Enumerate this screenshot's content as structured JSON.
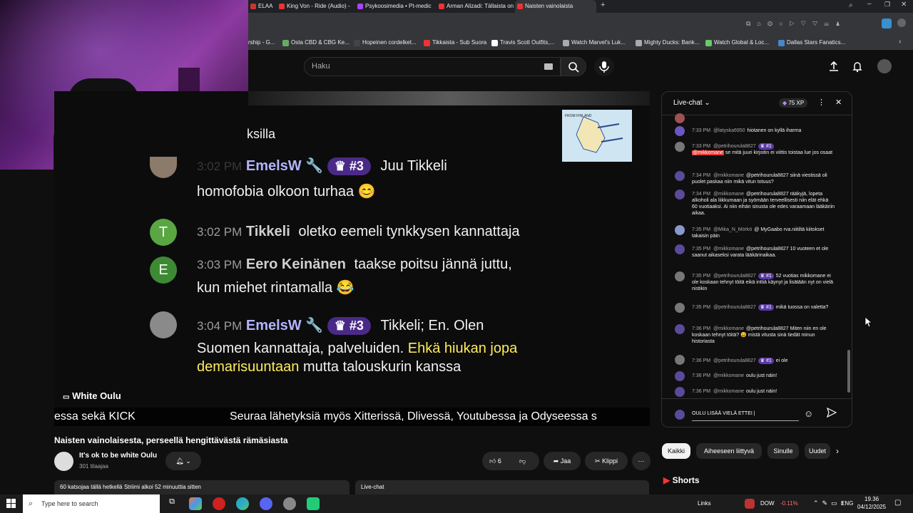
{
  "browser": {
    "tabs": [
      {
        "label": "ELAA",
        "color": "#c33"
      },
      {
        "label": "King Von - Ride (Audio) -",
        "color": "#e33"
      },
      {
        "label": "Psykoosimedia • Pt-medic",
        "color": "#a4f"
      },
      {
        "label": "Arman Alizadi: Tällaista on",
        "color": "#e33"
      },
      {
        "label": "Naisten vainolaista",
        "color": "#e33"
      }
    ],
    "bookmarks": [
      {
        "label": "rship - G...",
        "color": "#888"
      },
      {
        "label": "Osta CBD & CBG Ke...",
        "color": "#6a6"
      },
      {
        "label": "Hopeinen cordelket...",
        "color": "#444"
      },
      {
        "label": "Tikkaista - Sub Suora",
        "color": "#e33"
      },
      {
        "label": "Travis Scott Outfits,...",
        "color": "#fff"
      },
      {
        "label": "Watch Marvel's Luk...",
        "color": "#aaa"
      },
      {
        "label": "Mighty Ducks: Bank...",
        "color": "#aaa"
      },
      {
        "label": "Watch Global & Loc...",
        "color": "#6c6"
      },
      {
        "label": "Dallas Stars Fanatics...",
        "color": "#48c"
      }
    ]
  },
  "header": {
    "search_placeholder": "Haku"
  },
  "video": {
    "partial_top": "ksilla",
    "messages": [
      {
        "time": "3:02 PM",
        "name": "EmelsW",
        "rank": "#3",
        "text1": "Juu Tikkeli",
        "text2": "homofobia olkoon turhaa 😊"
      },
      {
        "avatar_letter": "T",
        "time": "3:02 PM",
        "name": "Tikkeli",
        "text1": "oletko eemeli tynkkysen kannattaja"
      },
      {
        "avatar_letter": "E",
        "time": "3:03 PM",
        "name": "Eero Keinänen",
        "text1": "taakse poitsu jännä juttu,",
        "text2": "kun miehet rintamalla 😂"
      },
      {
        "time": "3:04 PM",
        "name": "EmelsW",
        "rank": "#3",
        "text1": "Tikkeli; En. Olen",
        "text2a": "Suomen kannattaja, palveluiden.",
        "text2b": "Ehkä hiukan jopa",
        "text3a": "demarisuuntaan",
        "text3b": "mutta talouskurin kanssa"
      }
    ],
    "channel_overlay": "White Oulu",
    "ticker_left": "essa sekä KICK",
    "ticker_main": "Seuraa lähetyksiä myös Xitterissä, Dlivessä, Youtubessa ja Odyseessa s"
  },
  "below": {
    "title": "Naisten vainolaisesta, perseellä hengittävästä rämäsiasta",
    "channel": "It's ok to be white Oulu",
    "subs": "301 tilaajaa",
    "likes": "6",
    "share": "Jaa",
    "clip": "Klippi",
    "desc": "60 katsojaa tällä hetkellä Striimi alkoi 52 minuuttia sitten",
    "livechat_label": "Live-chat"
  },
  "chat": {
    "title": "Live-chat",
    "xp": "75 XP",
    "messages": [
      {
        "time": "7:33 PM",
        "user": "@latyska6950",
        "text": "hiotanen on kyllä iharma"
      },
      {
        "time": "7:33 PM",
        "user": "@petrihourula8827",
        "badge": "#1",
        "mention": "@mikkomane",
        "text": "se mitä juuri kirjoitin ei viittis toistaa lue jos osaat"
      },
      {
        "time": "7:34 PM",
        "user": "@mikkomane",
        "text": "@petrihourula8827 siinä viestissä oli puolet paskaa niin mikä vitun totuus?"
      },
      {
        "time": "7:34 PM",
        "user": "@mikkomane",
        "text": "@petrihourula8827 rääkyjä, lopeta alkoholi ala liikkumaan ja syömään terveellisesti niin elät ehkä 60 vuotiaaksi. Ai niin eihän sinusta ole edes varaamaan lääkäriin aikaa."
      },
      {
        "time": "7:35 PM",
        "user": "@Mika_N_Mörkö",
        "text": "@ MyGaabo rva.niitiltä kiitokset takaisin päin"
      },
      {
        "time": "7:35 PM",
        "user": "@mikkomane",
        "text": "@petrihourula8827 10 vuoteen et ole saanut aikaseksi varata lääkärinaikaa."
      },
      {
        "time": "7:35 PM",
        "user": "@petrihourula8827",
        "badge": "#1",
        "text": "52 vuotias mikkomane ei ole koskaan tehnyt töitä eikä inttiä käynyt ja lisätään nyt on vielä nistikin"
      },
      {
        "time": "7:35 PM",
        "user": "@petrihourula8827",
        "badge": "#1",
        "text": "mikä tuossa on valetta?"
      },
      {
        "time": "7:36 PM",
        "user": "@mikkomane",
        "text": "@petrihourula8827 Miten niin en ole koskaan tehnyt töitä? 😀 mistä vitusta sinä tiedät minun historiasta"
      },
      {
        "time": "7:36 PM",
        "user": "@petrihourula8827",
        "badge": "#1",
        "text": "ei ole"
      },
      {
        "time": "7:36 PM",
        "user": "@mikkomane",
        "text": "oulu just näin!"
      },
      {
        "time": "7:36 PM",
        "user": "@mikkomane",
        "text": "oulu just näin!"
      }
    ],
    "input_text": "OULU LISÄÄ VIELÄ ETTEI |"
  },
  "chips": [
    "Kaikki",
    "Aiheeseen liittyvä",
    "Sinulle",
    "Uudet"
  ],
  "shorts_label": "Shorts",
  "taskbar": {
    "search_placeholder": "Type here to search",
    "links": "Links",
    "stock": "DOW",
    "stock_change": "-0.11%",
    "lang": "ENG",
    "time": "19.36",
    "date": "04/12/2025"
  },
  "colors": {
    "accent": "#3ea6ff",
    "rank_badge": "#4a2a86",
    "stock_negative": "#ff6b6b"
  }
}
